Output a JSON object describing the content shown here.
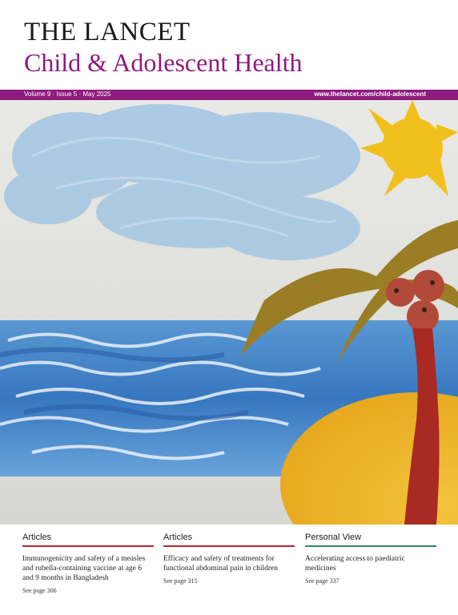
{
  "journal": {
    "title": "THE LANCET",
    "subtitle": "Child & Adolescent Health"
  },
  "issue": {
    "details": "Volume 9 · Issue 5 · May 2025",
    "url": "www.thelancet.com/child-adolescent"
  },
  "colors": {
    "brand_purple": "#8e1b7e",
    "rule_red": "#b5272d",
    "rule_green": "#2e8b57"
  },
  "footer": {
    "columns": [
      {
        "heading": "Articles",
        "text": "Immunogenicity and safety of a measles and rubella-containing vaccine at age 6 and 9 months in Bangladesh",
        "page": "See page 306"
      },
      {
        "heading": "Articles",
        "text": "Efficacy and safety of treatments for functional abdominal pain in children",
        "page": "See page 315"
      },
      {
        "heading": "Personal View",
        "text": "Accelerating access to paediatric medicines",
        "page": "See page 337"
      }
    ]
  }
}
